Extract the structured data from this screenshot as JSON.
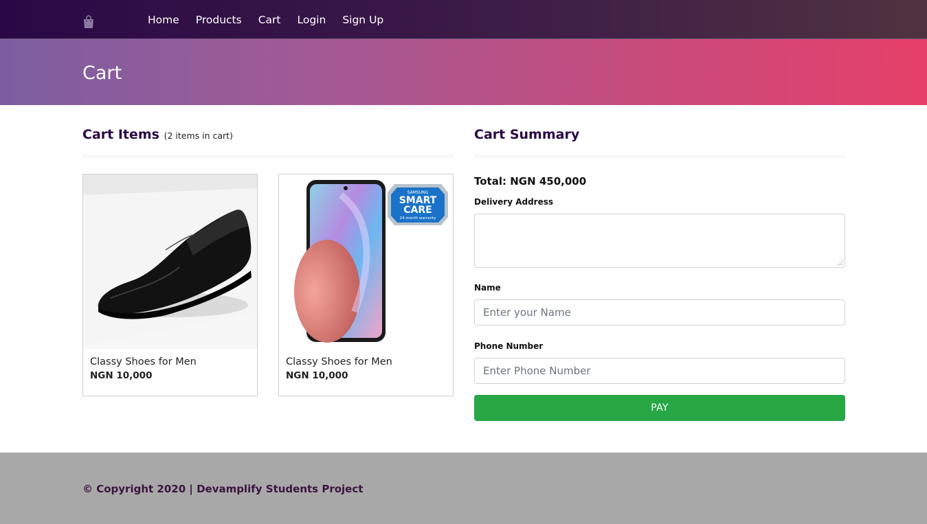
{
  "nav": {
    "brand_icon": "shopping-bag-icon",
    "links": [
      "Home",
      "Products",
      "Cart",
      "Login",
      "Sign Up"
    ]
  },
  "banner": {
    "title": "Cart"
  },
  "cart_items": {
    "title": "Cart Items",
    "count_text": "(2 items in cart)",
    "items": [
      {
        "name": "Classy Shoes for Men",
        "price": "NGN 10,000",
        "image": "black-leather-shoe-image"
      },
      {
        "name": "Classy Shoes for Men",
        "price": "NGN 10,000",
        "image": "smartphone-image",
        "badge": {
          "line1": "SAMSUNG",
          "line2": "SMART",
          "line3": "CARE",
          "line4": "24 month warranty"
        }
      }
    ]
  },
  "summary": {
    "title": "Cart Summary",
    "total": "Total: NGN 450,000",
    "delivery_label": "Delivery Address",
    "delivery_value": "",
    "name_label": "Name",
    "name_placeholder": "Enter your Name",
    "phone_label": "Phone Number",
    "phone_placeholder": "Enter Phone Number",
    "pay_label": "PAY",
    "pay_color": "#28a745"
  },
  "footer": {
    "text": "© Copyright 2020 | Devamplify Students Project"
  }
}
